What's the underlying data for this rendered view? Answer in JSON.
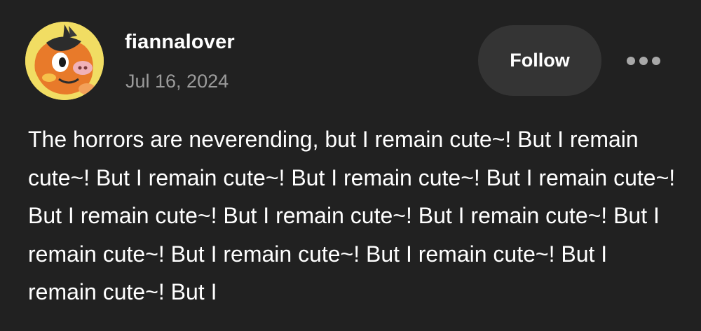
{
  "post": {
    "author": {
      "username": "fiannalover",
      "avatar_icon": "pixel-bird-avatar-icon"
    },
    "date": "Jul 16, 2024",
    "actions": {
      "follow_label": "Follow",
      "more_icon": "more-options-icon"
    },
    "body": "The horrors are neverending, but I remain cute~! But I remain cute~! But I remain cute~! But I remain cute~! But I remain cute~! But I remain cute~! But I remain cute~! But I remain cute~! But I remain cute~! But I remain cute~! But I remain cute~! But I remain cute~! But I"
  },
  "colors": {
    "background": "#212121",
    "follow_button_bg": "#343434",
    "date_text": "#9b9b9b",
    "more_dots": "#a8a8a8"
  }
}
